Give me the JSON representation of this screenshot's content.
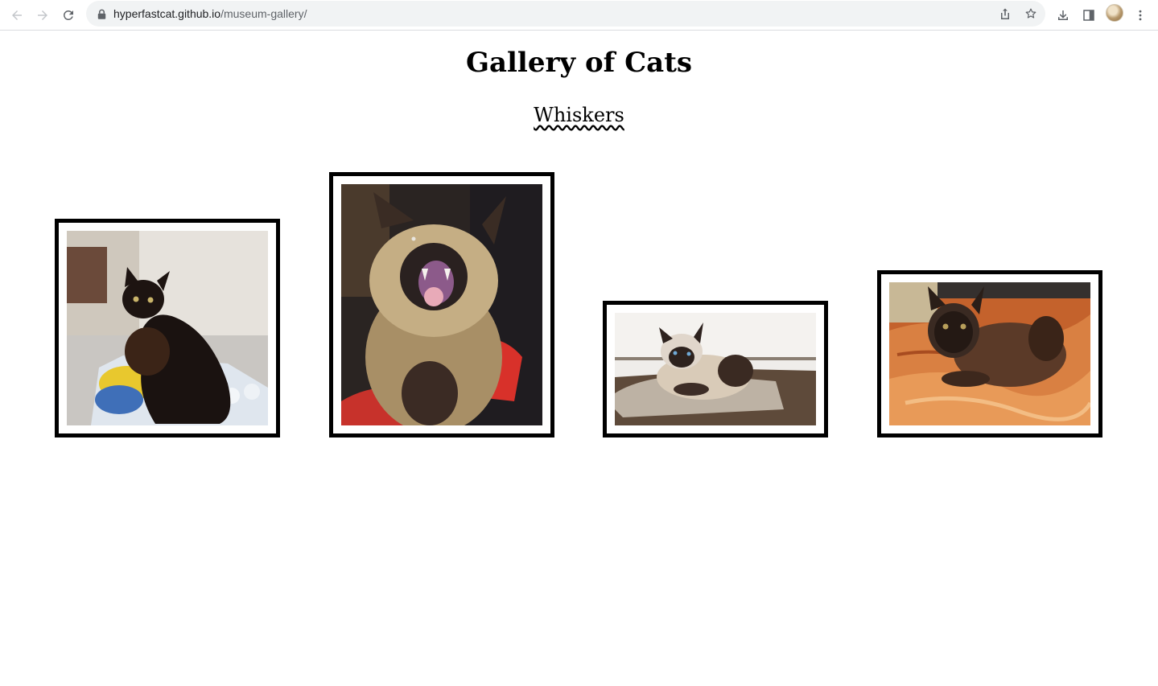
{
  "browser": {
    "url_host": "hyperfastcat.github.io",
    "url_path": "/museum-gallery/",
    "icons": [
      "back-arrow-icon",
      "forward-arrow-icon",
      "reload-icon",
      "lock-icon",
      "share-icon",
      "star-icon",
      "download-icon",
      "side-panel-icon",
      "profile-avatar",
      "more-vert-icon"
    ]
  },
  "page": {
    "title": "Gallery of Cats",
    "subtitle": "Whiskers"
  },
  "gallery": {
    "frame_color": "#000000",
    "photos": [
      {
        "depicts": "dark siamese cat sitting on water bottles by a wall"
      },
      {
        "depicts": "siamese cat meowing with open mouth"
      },
      {
        "depicts": "siamese cat loafing on a carpet"
      },
      {
        "depicts": "siamese cat lying on an orange blanket"
      }
    ]
  }
}
